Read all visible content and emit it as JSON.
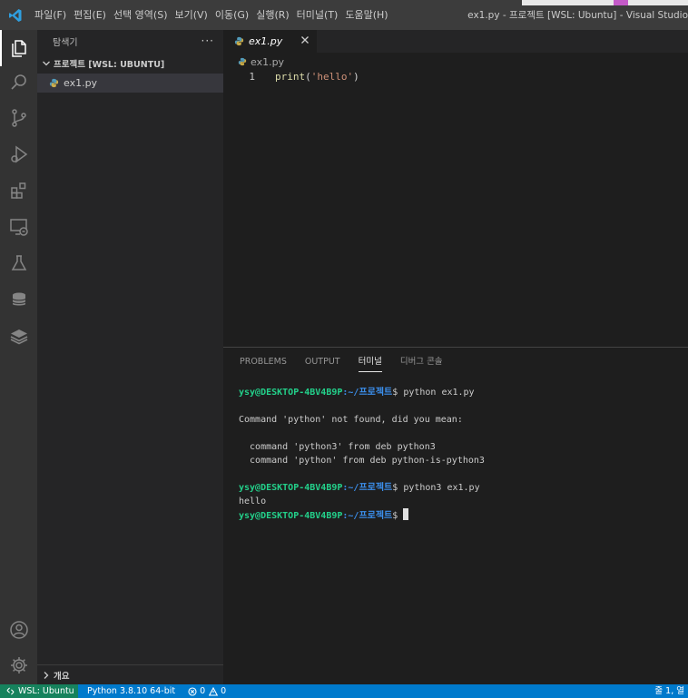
{
  "titlebar": {
    "menu": [
      "파일(F)",
      "편집(E)",
      "선택 영역(S)",
      "보기(V)",
      "이동(G)",
      "실행(R)",
      "터미널(T)",
      "도움말(H)"
    ],
    "window_title": "ex1.py - 프로젝트 [WSL: Ubuntu] - Visual Studio"
  },
  "activity_bar": {
    "icons": [
      "explorer-icon",
      "search-icon",
      "source-control-icon",
      "run-debug-icon",
      "extensions-icon",
      "remote-explorer-icon",
      "testing-icon",
      "database-icon",
      "layers-icon"
    ],
    "bottom_icons": [
      "account-icon",
      "settings-gear-icon"
    ]
  },
  "sidebar": {
    "title": "탐색기",
    "more": "···",
    "section": "프로젝트 [WSL: UBUNTU]",
    "files": [
      {
        "name": "ex1.py"
      }
    ],
    "outline": "개요"
  },
  "editor": {
    "tab_label": "ex1.py",
    "breadcrumb": "ex1.py",
    "line_number": "1",
    "code": {
      "fn": "print",
      "open": "(",
      "str": "'hello'",
      "close": ")"
    }
  },
  "panel": {
    "tabs": [
      "PROBLEMS",
      "OUTPUT",
      "터미널",
      "디버그 콘솔"
    ],
    "active_tab": "터미널",
    "prompt_user": "ysy@DESKTOP-4BV4B9P",
    "prompt_path": ":~/프로젝트",
    "prompt_sym": "$ ",
    "terminal": {
      "cmd1": "python ex1.py",
      "err": "Command 'python' not found, did you mean:",
      "sugg1": "  command 'python3' from deb python3",
      "sugg2": "  command 'python' from deb python-is-python3",
      "cmd2": "python3 ex1.py",
      "out": "hello"
    }
  },
  "statusbar": {
    "remote": "WSL: Ubuntu",
    "python": "Python 3.8.10 64-bit",
    "errors": "0",
    "warnings": "0",
    "position": "줄 1, 열"
  },
  "colors": {
    "accent": "#007acc",
    "remote": "#16825d",
    "prompt_user": "#23d18b",
    "prompt_path": "#3b8eea"
  }
}
